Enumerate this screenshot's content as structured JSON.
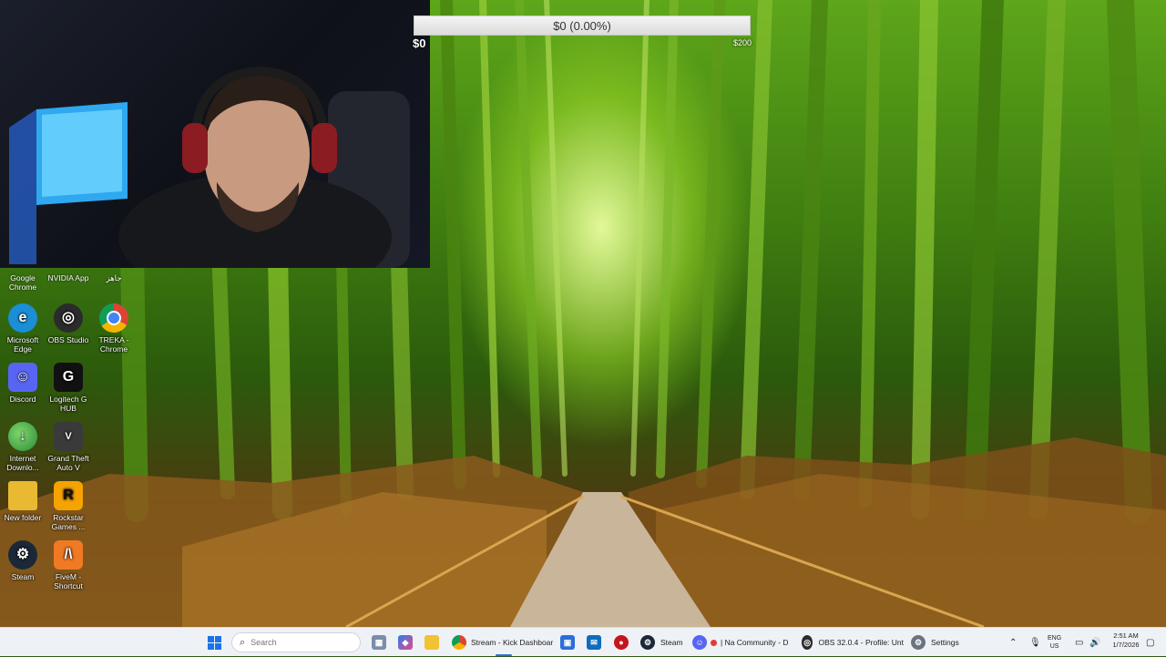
{
  "stream_overlay": {
    "goal_text": "$0 (0.00%)",
    "goal_min": "$0",
    "goal_max": "$200",
    "goal_progress_percent": 0
  },
  "desktop": {
    "top_row": [
      "Google Chrome",
      "NVIDIA App",
      "جاهز"
    ],
    "icons": [
      {
        "label": "Microsoft Edge",
        "icon": "edge-icon",
        "color": "#1a8fd6"
      },
      {
        "label": "OBS Studio",
        "icon": "obs-icon",
        "color": "#2b2b2b"
      },
      {
        "label": "TREKA - Chrome",
        "icon": "chrome-icon",
        "color": "#db4437"
      },
      {
        "label": "Discord",
        "icon": "discord-icon",
        "color": "#5865f2"
      },
      {
        "label": "Logitech G HUB",
        "icon": "logitech-icon",
        "color": "#111111"
      },
      {
        "label": "Internet Downlo...",
        "icon": "idm-icon",
        "color": "#3aa14a"
      },
      {
        "label": "Grand Theft Auto V",
        "icon": "gta-icon",
        "color": "#3a3a3a"
      },
      {
        "label": "New folder",
        "icon": "folder-icon",
        "color": "#e8b931"
      },
      {
        "label": "Rockstar Games ...",
        "icon": "rockstar-icon",
        "color": "#f5a300"
      },
      {
        "label": "Steam",
        "icon": "steam-icon",
        "color": "#1b2838"
      },
      {
        "label": "FiveM - Shortcut",
        "icon": "fivem-icon",
        "color": "#f07a24"
      }
    ]
  },
  "taskbar": {
    "search_placeholder": "Search",
    "apps": [
      {
        "label": "Stream - Kick Dashboar",
        "icon": "chrome-icon"
      },
      {
        "label": "Steam",
        "icon": "steam-icon"
      },
      {
        "label": "| Na Community - D",
        "icon": "discord-icon"
      },
      {
        "label": "OBS 32.0.4 - Profile: Unt",
        "icon": "obs-icon"
      },
      {
        "label": "Settings",
        "icon": "gear-icon"
      }
    ],
    "language": "ENG",
    "region": "US",
    "time": "2:51 AM",
    "date": "1/7/2026"
  }
}
